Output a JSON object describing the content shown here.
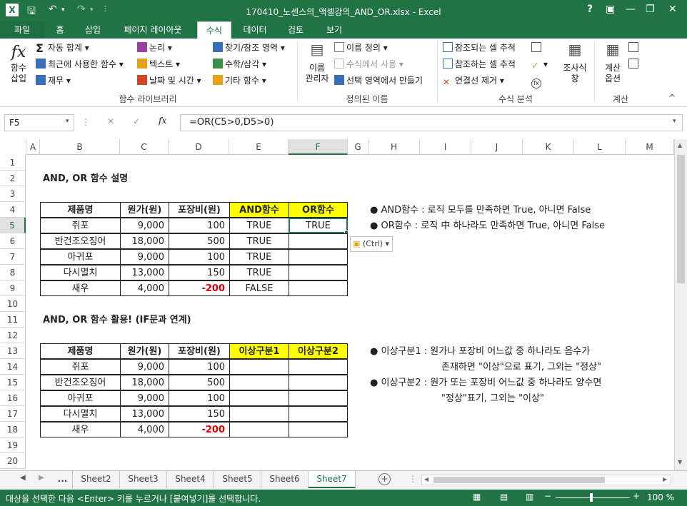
{
  "window": {
    "title": "170410_노센스의_액셀강의_AND_OR.xlsx - Excel",
    "help": "?"
  },
  "tabs": [
    "파일",
    "홈",
    "삽입",
    "페이지 레이아웃",
    "수식",
    "데이터",
    "검토",
    "보기"
  ],
  "ribbon": {
    "insert_function": [
      "함수",
      "삽입"
    ],
    "autosum": "자동 합계",
    "recent": "최근에 사용한 함수",
    "financial": "재무",
    "logical": "논리",
    "text": "텍스트",
    "datetime": "날짜 및 시간",
    "lookup": "찾기/참조 영역",
    "math": "수학/삼각",
    "more": "기타 함수",
    "group1": "함수 라이브러리",
    "name_manager": [
      "이름",
      "관리자"
    ],
    "define_name": "이름 정의",
    "use_in_formula": "수식에서 사용",
    "create_from_sel": "선택 영역에서 만들기",
    "group2": "정의된 이름",
    "trace_precedents": "참조되는 셀 추적",
    "trace_dependents": "참조하는 셀 추적",
    "remove_arrows": "연결선 제거",
    "watch_window": [
      "조사식",
      "창"
    ],
    "group3": "수식 분석",
    "calc_options": [
      "계산",
      "옵션"
    ],
    "group4": "계산"
  },
  "formula_bar": {
    "name_box": "F5",
    "fx": "fx",
    "formula": "=OR(C5>0,D5>0)"
  },
  "columns": [
    "A",
    "B",
    "C",
    "D",
    "E",
    "F",
    "G",
    "H",
    "I",
    "J",
    "K",
    "L",
    "M"
  ],
  "rows": [
    "1",
    "2",
    "3",
    "4",
    "5",
    "6",
    "7",
    "8",
    "9",
    "10",
    "11",
    "12",
    "13",
    "14",
    "15",
    "16",
    "17",
    "18",
    "19",
    "20"
  ],
  "section1": {
    "title": "AND, OR 함수 설명",
    "headers": [
      "제품명",
      "원가(원)",
      "포장비(원)",
      "AND함수",
      "OR함수"
    ],
    "rows": [
      {
        "name": "쥐포",
        "cost": "9,000",
        "pack": "100",
        "and": "TRUE",
        "or": "TRUE"
      },
      {
        "name": "반건조오징어",
        "cost": "18,000",
        "pack": "500",
        "and": "TRUE",
        "or": ""
      },
      {
        "name": "아귀포",
        "cost": "9,000",
        "pack": "100",
        "and": "TRUE",
        "or": ""
      },
      {
        "name": "다시멸치",
        "cost": "13,000",
        "pack": "150",
        "and": "TRUE",
        "or": ""
      },
      {
        "name": "새우",
        "cost": "4,000",
        "pack": "-200",
        "and": "FALSE",
        "or": ""
      }
    ],
    "notes": [
      "AND함수 : 로직 모두를 만족하면 True, 아니면 False",
      "OR함수 : 로직 中 하나라도 만족하면 True, 아니면 False"
    ],
    "paste_options": "(Ctrl)"
  },
  "section2": {
    "title": "AND, OR 함수 활용! (IF문과 연계)",
    "headers": [
      "제품명",
      "원가(원)",
      "포장비(원)",
      "이상구분1",
      "이상구분2"
    ],
    "rows": [
      {
        "name": "쥐포",
        "cost": "9,000",
        "pack": "100"
      },
      {
        "name": "반건조오징어",
        "cost": "18,000",
        "pack": "500"
      },
      {
        "name": "아귀포",
        "cost": "9,000",
        "pack": "100"
      },
      {
        "name": "다시멸치",
        "cost": "13,000",
        "pack": "150"
      },
      {
        "name": "새우",
        "cost": "4,000",
        "pack": "-200"
      }
    ],
    "notes": [
      [
        "이상구분1 : 원가나 포장비 어느값 중 하나라도 음수가",
        "존재하면 \"이상\"으로 표기, 그외는 \"정상\""
      ],
      [
        "이상구분2 : 원가 또는 포장비 어느값 중 하나라도 양수면",
        "\"정상\"표기, 그외는 \"이상\""
      ]
    ]
  },
  "sheets": [
    "...",
    "Sheet2",
    "Sheet3",
    "Sheet4",
    "Sheet5",
    "Sheet6",
    "Sheet7"
  ],
  "active_sheet": "Sheet7",
  "status": {
    "message": "대상을 선택한 다음 <Enter> 키를 누르거나 [붙여넣기]를 선택합니다.",
    "zoom": "100 %"
  },
  "colors": {
    "accent": "#217346",
    "highlight": "#ffff00",
    "negative": "#e00000"
  }
}
